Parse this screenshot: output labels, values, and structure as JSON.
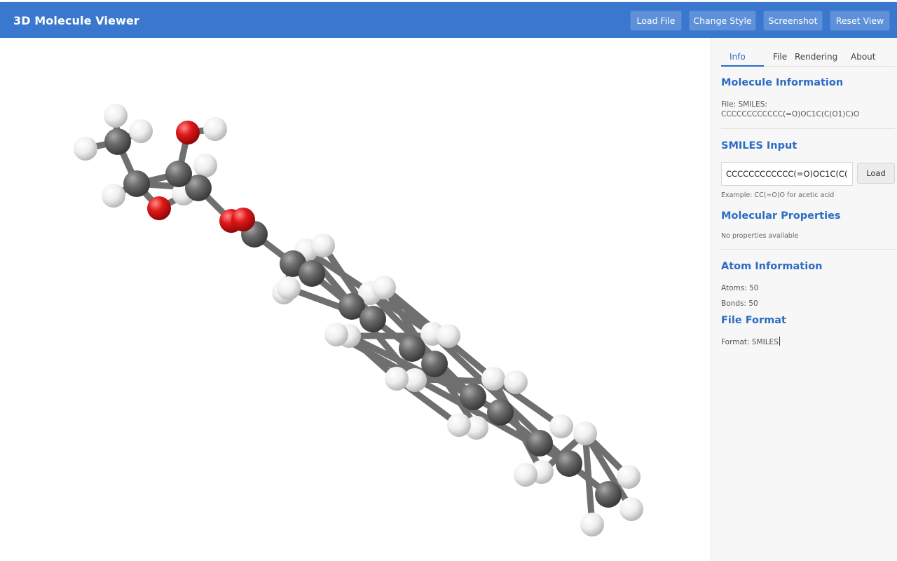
{
  "header": {
    "title": "3D Molecule Viewer",
    "buttons": {
      "load_file": "Load File",
      "change_style": "Change Style",
      "screenshot": "Screenshot",
      "reset_view": "Reset View"
    }
  },
  "tabs": [
    "Info",
    "File",
    "Rendering",
    "About"
  ],
  "panel": {
    "molecule_info": {
      "title": "Molecule Information",
      "file_line": "File: SMILES:",
      "file_smiles": "CCCCCCCCCCCC(=O)OC1C(C(O1)C)O"
    },
    "smiles_input": {
      "title": "SMILES Input",
      "value": "CCCCCCCCCCCC(=O)OC1C(C(O1)C)O",
      "load_label": "Load",
      "example": "Example: CC(=O)O for acetic acid"
    },
    "properties": {
      "title": "Molecular Properties",
      "text": "No properties available"
    },
    "atom_info": {
      "title": "Atom Information",
      "atoms": "Atoms: 50",
      "bonds": "Bonds: 50"
    },
    "file_format": {
      "title": "File Format",
      "format": "Format: SMILES"
    }
  },
  "colors": {
    "header": "#3a78cf",
    "accent": "#2c6cc4",
    "carbon": "#5a5a5a",
    "oxygen": "#d91a1a",
    "hydrogen": "#f2f2f2"
  }
}
